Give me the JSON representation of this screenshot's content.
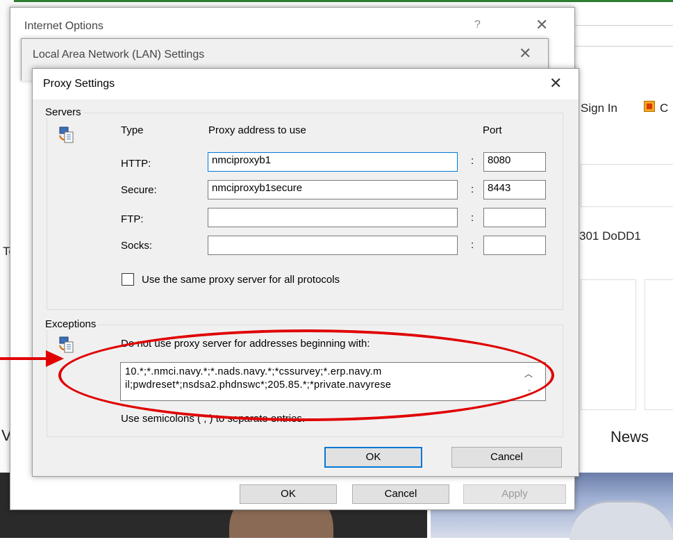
{
  "background_page": {
    "sign_in": "Sign In",
    "partial_c": "C",
    "doc_ref": "301  DoDD1",
    "partial_left_1": "To",
    "partial_left_2": "V",
    "news": "News"
  },
  "internet_options": {
    "title": "Internet Options",
    "help": "?",
    "buttons": {
      "ok": "OK",
      "cancel": "Cancel",
      "apply": "Apply"
    }
  },
  "lan_settings": {
    "title": "Local Area Network (LAN) Settings"
  },
  "proxy_settings": {
    "title": "Proxy Settings",
    "servers": {
      "group_label": "Servers",
      "col_type": "Type",
      "col_address": "Proxy address to use",
      "col_port": "Port",
      "rows": [
        {
          "type": "HTTP:",
          "address": "nmciproxyb1",
          "port": "8080"
        },
        {
          "type": "Secure:",
          "address": "nmciproxyb1secure",
          "port": "8443"
        },
        {
          "type": "FTP:",
          "address": "",
          "port": ""
        },
        {
          "type": "Socks:",
          "address": "",
          "port": ""
        }
      ],
      "separator": ":",
      "same_proxy_label": "Use the same proxy server for all protocols"
    },
    "exceptions": {
      "group_label": "Exceptions",
      "instruction": "Do not use proxy server for addresses beginning with:",
      "line1": "10.*;*.nmci.navy.*;*.nads.navy.*;*cssurvey;*.erp.navy.m",
      "line2": "il;pwdreset*;nsdsa2.phdnswc*;205.85.*;*private.navyrese",
      "hint": "Use semicolons ( ; ) to separate entries."
    },
    "buttons": {
      "ok": "OK",
      "cancel": "Cancel"
    }
  },
  "annotation": {
    "color": "#e00000"
  }
}
